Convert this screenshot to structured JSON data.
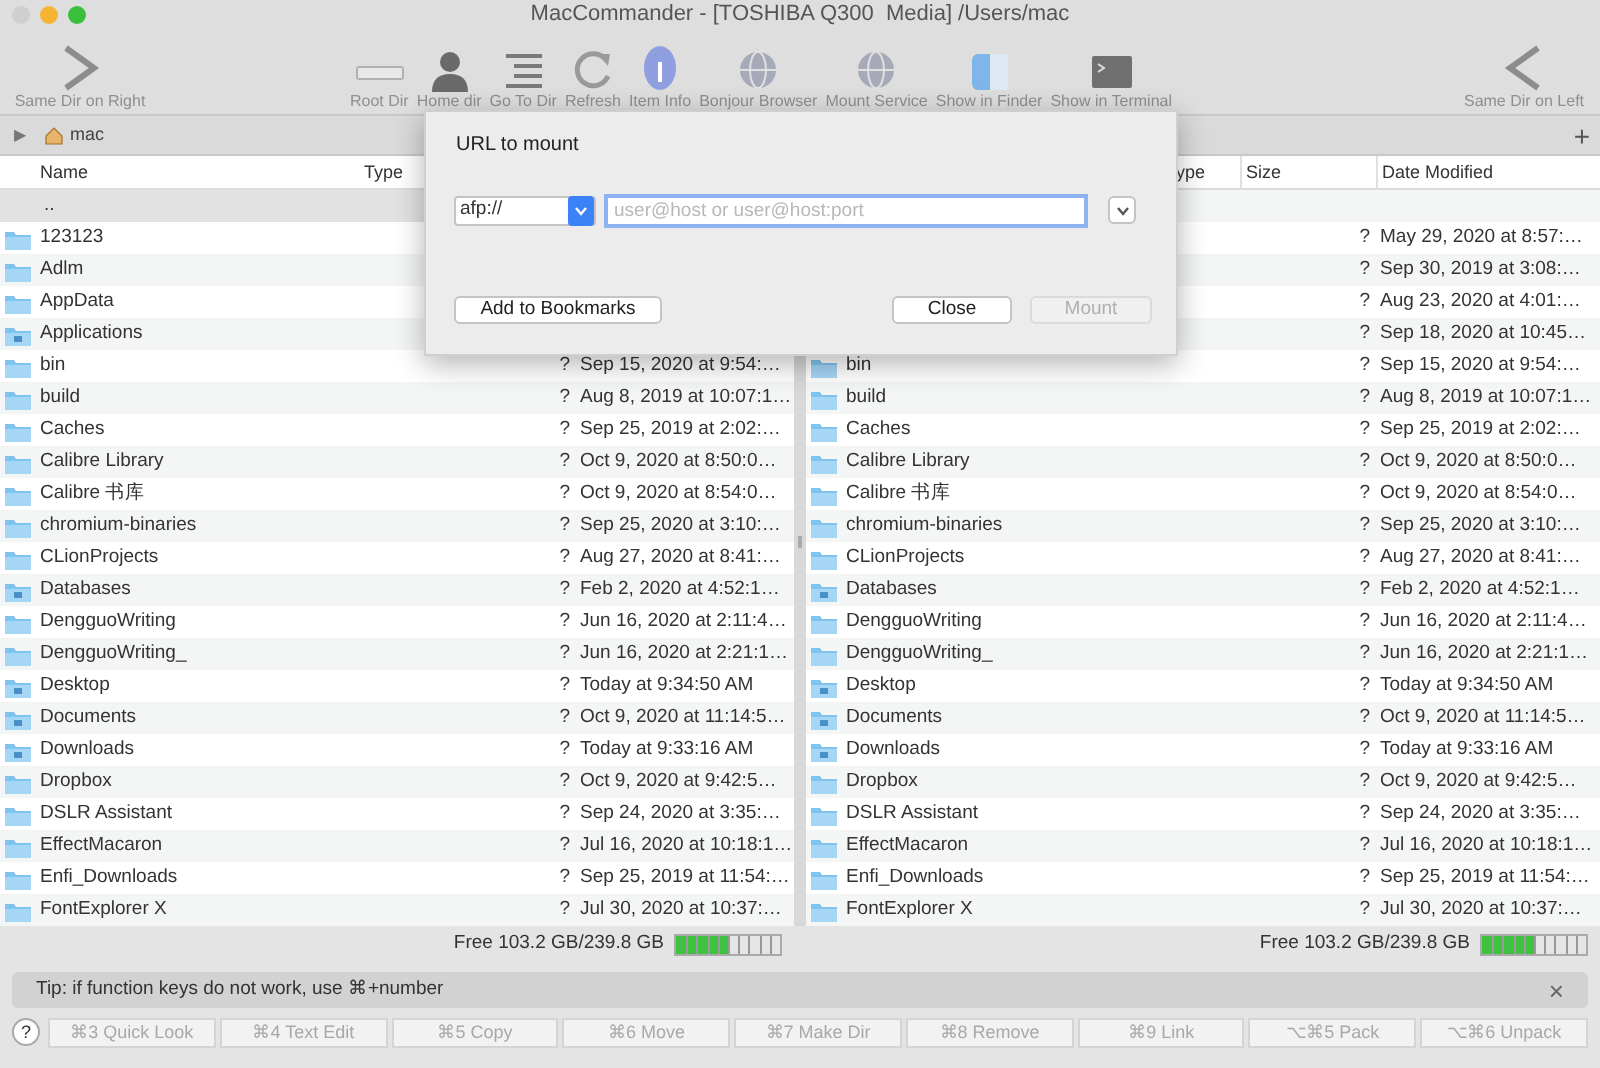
{
  "window": {
    "title": "MacCommander - [TOSHIBA Q300  Media] /Users/mac"
  },
  "toolbar": {
    "left": {
      "label": "Same Dir on Right",
      "kind": "chevron-right"
    },
    "items": [
      {
        "label": "Root Dir",
        "kind": "drive"
      },
      {
        "label": "Home dir",
        "kind": "person"
      },
      {
        "label": "Go To Dir",
        "kind": "list"
      },
      {
        "label": "Refresh",
        "kind": "refresh"
      },
      {
        "label": "Item Info",
        "kind": "info"
      },
      {
        "label": "Bonjour Browser",
        "kind": "globe"
      },
      {
        "label": "Mount Service",
        "kind": "globe"
      },
      {
        "label": "Show in Finder",
        "kind": "finder"
      },
      {
        "label": "Show in Terminal",
        "kind": "terminal"
      }
    ],
    "right": {
      "label": "Same Dir on Left",
      "kind": "chevron-left"
    }
  },
  "path_bar": {
    "toggle": "▶",
    "folder": "mac",
    "add": "+"
  },
  "panels": [
    {
      "columns": [
        {
          "label": "Name"
        },
        {
          "label": "Type"
        }
      ],
      "rows": [
        {
          "kind": "parent",
          "name": "..",
          "selected": true
        },
        {
          "kind": "folder",
          "name": "123123",
          "selected": false
        },
        {
          "kind": "folder",
          "name": "Adlm",
          "selected": false
        },
        {
          "kind": "folder",
          "name": "AppData",
          "selected": false
        },
        {
          "kind": "special",
          "name": "Applications",
          "selected": false
        },
        {
          "kind": "folder",
          "name": "bin",
          "size": "?",
          "date": "Sep 15, 2020 at 9:54:…",
          "selected": false
        },
        {
          "kind": "folder",
          "name": "build",
          "size": "?",
          "date": "Aug 8, 2019 at 10:07:1…",
          "selected": false
        },
        {
          "kind": "folder",
          "name": "Caches",
          "size": "?",
          "date": "Sep 25, 2019 at 2:02:…",
          "selected": false
        },
        {
          "kind": "folder",
          "name": "Calibre Library",
          "size": "?",
          "date": "Oct 9, 2020 at 8:50:0…",
          "selected": false
        },
        {
          "kind": "folder",
          "name": "Calibre 书库",
          "size": "?",
          "date": "Oct 9, 2020 at 8:54:0…",
          "selected": false
        },
        {
          "kind": "folder",
          "name": "chromium-binaries",
          "size": "?",
          "date": "Sep 25, 2020 at 3:10:…",
          "selected": false
        },
        {
          "kind": "folder",
          "name": "CLionProjects",
          "size": "?",
          "date": "Aug 27, 2020 at 8:41:…",
          "selected": false
        },
        {
          "kind": "special",
          "name": "Databases",
          "size": "?",
          "date": "Feb 2, 2020 at 4:52:1…",
          "selected": false
        },
        {
          "kind": "folder",
          "name": "DengguoWriting",
          "size": "?",
          "date": "Jun 16, 2020 at 2:11:4…",
          "selected": false
        },
        {
          "kind": "folder",
          "name": "DengguoWriting_",
          "size": "?",
          "date": "Jun 16, 2020 at 2:21:1…",
          "selected": false
        },
        {
          "kind": "special",
          "name": "Desktop",
          "size": "?",
          "date": "Today at 9:34:50 AM",
          "selected": false
        },
        {
          "kind": "special",
          "name": "Documents",
          "size": "?",
          "date": "Oct 9, 2020 at 11:14:5…",
          "selected": false
        },
        {
          "kind": "special",
          "name": "Downloads",
          "size": "?",
          "date": "Today at 9:33:16 AM",
          "selected": false
        },
        {
          "kind": "folder",
          "name": "Dropbox",
          "size": "?",
          "date": "Oct 9, 2020 at 9:42:5…",
          "selected": false
        },
        {
          "kind": "folder",
          "name": "DSLR Assistant",
          "size": "?",
          "date": "Sep 24, 2020 at 3:35:…",
          "selected": false
        },
        {
          "kind": "folder",
          "name": "EffectMacaron",
          "size": "?",
          "date": "Jul 16, 2020 at 10:18:1…",
          "selected": false
        },
        {
          "kind": "folder",
          "name": "Enfi_Downloads",
          "size": "?",
          "date": "Sep 25, 2019 at 11:54:…",
          "selected": false
        },
        {
          "kind": "folder",
          "name": "FontExplorer X",
          "size": "?",
          "date": "Jul 30, 2020 at 10:37:…",
          "selected": false
        }
      ],
      "free": {
        "label": "Free 103.2 GB/239.8 GB",
        "level": 0.5
      }
    },
    {
      "columns": [
        {
          "label": "ype"
        },
        {
          "label": "Size"
        },
        {
          "label": "Date Modified"
        }
      ],
      "rows": [
        {
          "kind": "parent",
          "selected": false
        },
        {
          "kind": "hidden",
          "size": "?",
          "date": "May 29, 2020 at 8:57:…",
          "selected": false
        },
        {
          "kind": "hidden",
          "size": "?",
          "date": "Sep 30, 2019 at 3:08:…",
          "selected": false
        },
        {
          "kind": "hidden",
          "size": "?",
          "date": "Aug 23, 2020 at 4:01:…",
          "selected": false
        },
        {
          "kind": "hidden",
          "size": "?",
          "date": "Sep 18, 2020 at 10:45…",
          "selected": false
        },
        {
          "kind": "folder",
          "name": "bin",
          "size": "?",
          "date": "Sep 15, 2020 at 9:54:…",
          "selected": false
        },
        {
          "kind": "folder",
          "name": "build",
          "size": "?",
          "date": "Aug 8, 2019 at 10:07:1…",
          "selected": false
        },
        {
          "kind": "folder",
          "name": "Caches",
          "size": "?",
          "date": "Sep 25, 2019 at 2:02:…",
          "selected": false
        },
        {
          "kind": "folder",
          "name": "Calibre Library",
          "size": "?",
          "date": "Oct 9, 2020 at 8:50:0…",
          "selected": false
        },
        {
          "kind": "folder",
          "name": "Calibre 书库",
          "size": "?",
          "date": "Oct 9, 2020 at 8:54:0…",
          "selected": false
        },
        {
          "kind": "folder",
          "name": "chromium-binaries",
          "size": "?",
          "date": "Sep 25, 2020 at 3:10:…",
          "selected": false
        },
        {
          "kind": "folder",
          "name": "CLionProjects",
          "size": "?",
          "date": "Aug 27, 2020 at 8:41:…",
          "selected": false
        },
        {
          "kind": "special",
          "name": "Databases",
          "size": "?",
          "date": "Feb 2, 2020 at 4:52:1…",
          "selected": false
        },
        {
          "kind": "folder",
          "name": "DengguoWriting",
          "size": "?",
          "date": "Jun 16, 2020 at 2:11:4…",
          "selected": false
        },
        {
          "kind": "folder",
          "name": "DengguoWriting_",
          "size": "?",
          "date": "Jun 16, 2020 at 2:21:1…",
          "selected": false
        },
        {
          "kind": "special",
          "name": "Desktop",
          "size": "?",
          "date": "Today at 9:34:50 AM",
          "selected": false
        },
        {
          "kind": "special",
          "name": "Documents",
          "size": "?",
          "date": "Oct 9, 2020 at 11:14:5…",
          "selected": false
        },
        {
          "kind": "special",
          "name": "Downloads",
          "size": "?",
          "date": "Today at 9:33:16 AM",
          "selected": false
        },
        {
          "kind": "folder",
          "name": "Dropbox",
          "size": "?",
          "date": "Oct 9, 2020 at 9:42:5…",
          "selected": false
        },
        {
          "kind": "folder",
          "name": "DSLR Assistant",
          "size": "?",
          "date": "Sep 24, 2020 at 3:35:…",
          "selected": false
        },
        {
          "kind": "folder",
          "name": "EffectMacaron",
          "size": "?",
          "date": "Jul 16, 2020 at 10:18:1…",
          "selected": false
        },
        {
          "kind": "folder",
          "name": "Enfi_Downloads",
          "size": "?",
          "date": "Sep 25, 2019 at 11:54:…",
          "selected": false
        },
        {
          "kind": "folder",
          "name": "FontExplorer X",
          "size": "?",
          "date": "Jul 30, 2020 at 10:37:…",
          "selected": false
        }
      ],
      "free": {
        "label": "Free 103.2 GB/239.8 GB",
        "level": 0.5
      }
    }
  ],
  "tip": {
    "text": "Tip: if function keys do not work, use ⌘+number",
    "close": "×"
  },
  "function_keys": {
    "help": "?",
    "keys": [
      {
        "label": "⌘3 Quick Look",
        "disabled": true
      },
      {
        "label": "⌘4 Text Edit",
        "disabled": true
      },
      {
        "label": "⌘5 Copy",
        "disabled": true
      },
      {
        "label": "⌘6 Move",
        "disabled": true
      },
      {
        "label": "⌘7 Make Dir",
        "disabled": true
      },
      {
        "label": "⌘8 Remove",
        "disabled": true
      },
      {
        "label": "⌘9 Link",
        "disabled": true
      },
      {
        "label": "⌥⌘5 Pack",
        "disabled": true
      },
      {
        "label": "⌥⌘6 Unpack",
        "disabled": true
      }
    ]
  },
  "dialog": {
    "title": "URL to mount",
    "protocol": "afp://",
    "placeholder": "user@host or user@host:port",
    "focused": true,
    "buttons": [
      {
        "label": "Add to Bookmarks",
        "disabled": false
      },
      {
        "label": "Close",
        "disabled": false
      },
      {
        "label": "Mount",
        "disabled": true
      }
    ]
  }
}
